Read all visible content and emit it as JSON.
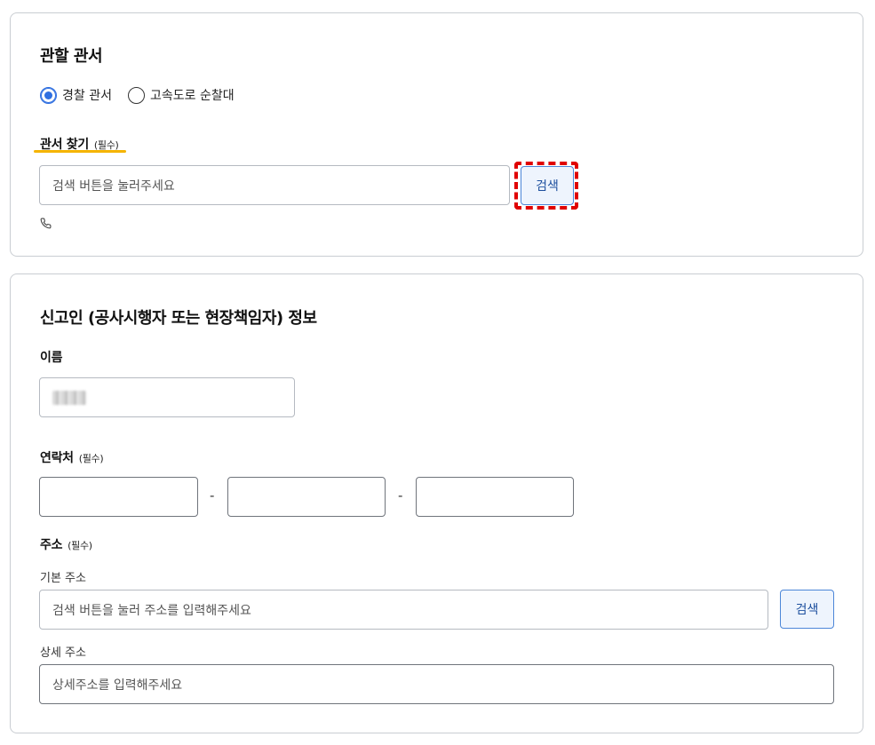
{
  "jurisdiction": {
    "title": "관할 관서",
    "radios": [
      {
        "label": "경찰 관서",
        "selected": true
      },
      {
        "label": "고속도로 순찰대",
        "selected": false
      }
    ],
    "find_label": "관서 찾기",
    "required": "(필수)",
    "search_placeholder": "검색 버튼을 눌러주세요",
    "search_button": "검색",
    "phone_icon": "phone-icon"
  },
  "reporter": {
    "title": "신고인 (공사시행자 또는 현장책임자) 정보",
    "name_label": "이름",
    "contact_label": "연락처",
    "contact_required": "(필수)",
    "dash": "-",
    "address_label": "주소",
    "address_required": "(필수)",
    "basic_address_label": "기본 주소",
    "basic_address_placeholder": "검색 버튼을 눌러 주소를 입력해주세요",
    "address_search_button": "검색",
    "detail_address_label": "상세 주소",
    "detail_address_placeholder": "상세주소를 입력해주세요"
  },
  "colors": {
    "accent_blue": "#2f6fe0",
    "highlight_yellow": "#f5b400",
    "focus_red": "#e00000"
  }
}
